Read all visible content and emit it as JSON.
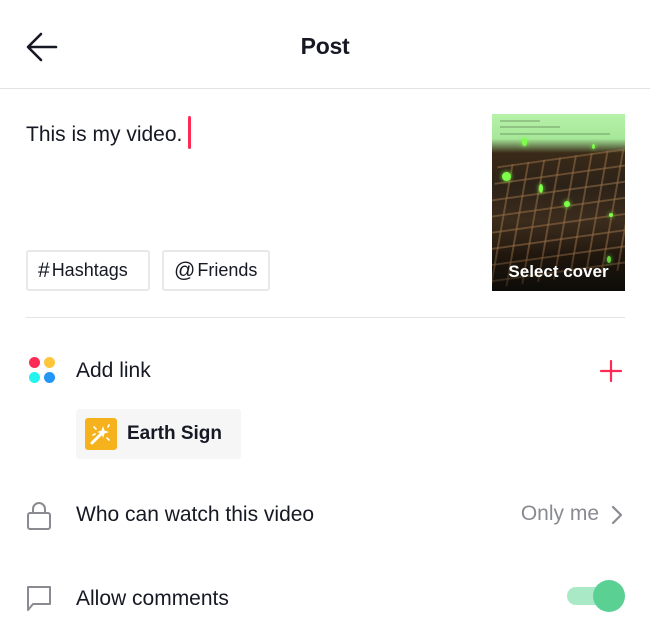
{
  "header": {
    "title": "Post",
    "back_icon": "arrow-left-icon"
  },
  "caption": {
    "value": "This is my video.",
    "cursor_color": "#fe2c55"
  },
  "tags": {
    "hashtags": {
      "symbol": "#",
      "label": "Hashtags"
    },
    "friends": {
      "symbol": "@",
      "label": "Friends"
    }
  },
  "cover": {
    "label": "Select cover"
  },
  "add_link": {
    "label": "Add link",
    "icon": "apps-dots-icon",
    "dot_colors": [
      "#fe2c55",
      "#ffc53d",
      "#25f4ee",
      "#2295f5"
    ],
    "action_icon": "plus-icon",
    "accent": "#fe2c55"
  },
  "linked_item": {
    "label": "Earth Sign",
    "icon": "effect-sparkle-icon",
    "icon_bg": "#f6b21c"
  },
  "privacy": {
    "label": "Who can watch this video",
    "value": "Only me",
    "icon": "lock-icon",
    "chevron": "chevron-right-icon"
  },
  "comments": {
    "label": "Allow comments",
    "icon": "comment-icon",
    "enabled": true,
    "toggle_color": "#5ad193"
  }
}
